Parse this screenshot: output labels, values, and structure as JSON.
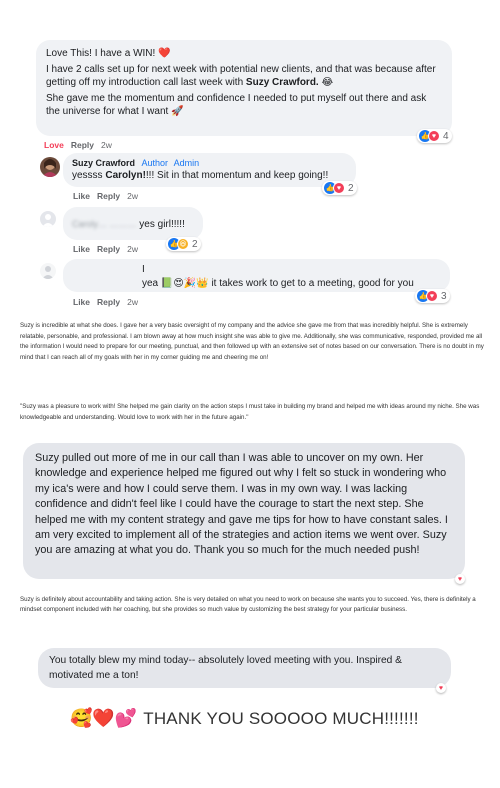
{
  "comment1": {
    "lines": [
      "Love This! I have a WIN! ❤️",
      "I have 2 calls set up for next week with potential new clients, and that was because after getting off my introduction call last week with",
      "Suzy Crawford.",
      "She gave me the momentum and confidence I needed to put myself out there and ask the universe for what I want 🚀"
    ],
    "reaction_count": "4",
    "action_love": "Love",
    "action_reply": "Reply",
    "time": "2w"
  },
  "reply1": {
    "author": "Suzy Crawford",
    "badge_author": "Author",
    "badge_admin": "Admin",
    "text_pre": "yessss",
    "mention": "Carolyn!",
    "text_post": "!!! Sit in that momentum and keep going!!",
    "reaction_count": "2",
    "action_like": "Like",
    "action_reply": "Reply",
    "time": "2w"
  },
  "reply2": {
    "blurred_name": "Caroly… ………",
    "text": "yes girl!!!!!",
    "reaction_count": "2",
    "action_like": "Like",
    "action_reply": "Reply",
    "time": "2w"
  },
  "reply3": {
    "line1": "I",
    "line2": "yea 📗😍🎉👑 it takes work to get to a meeting, good for you",
    "reaction_count": "3",
    "action_like": "Like",
    "action_reply": "Reply",
    "time": "2w"
  },
  "testimonial1": "Suzy is incredible at what she does.  I gave her a very basic oversight of my company and the advice she gave me from that was incredibly helpful.  She is extremely relatable, personable, and professional.  I am blown away at how much insight she was able to give me.  Additionally, she was communicative, responded, provided me all the information I would need to prepare for our meeting, punctual, and then followed up with an extensive set of notes based on our conversation.  There is no doubt in my mind that I can reach all of my goals with her in my corner guiding me and cheering me on!",
  "testimonial2": "\"Suzy was a pleasure to work with!  She helped me gain clarity on the action steps I must take in building my brand and  helped me with ideas around my niche. She was knowledgeable and understanding. Would love to work with her in the future again.\"",
  "big_message": "Suzy pulled out more of me in our call than I was able to uncover on my own. Her knowledge and experience helped me figured out why I felt so stuck in wondering who my ica's were and how I could serve them. I was in my own way. I was lacking confidence and didn't feel like I could have the courage to start the next step. She helped me with my content strategy and gave me tips for how to have constant sales. I am very excited to implement all of the strategies and action items we went over. Suzy you are amazing at what you do. Thank you so much for the much needed push!",
  "testimonial3": "Suzy is definitely about accountability and taking action. She is very detailed on what you need to work on because she wants you to succeed. Yes, there is definitely a mindset component included with her coaching, but she provides so much value by customizing the best strategy for your particular business.",
  "small_message": "You totally blew my mind today-- absolutely loved meeting with you. Inspired & motivated me a ton!",
  "thanks": {
    "emojis": "🥰❤️💕",
    "text": "THANK YOU SOOOOO MUCH!!!!!!!"
  },
  "colors": {
    "facebook_blue": "#1877f2",
    "love_red": "#f33e58",
    "bubble_grey": "#f0f2f5",
    "big_bubble_grey": "#e4e6eb"
  }
}
